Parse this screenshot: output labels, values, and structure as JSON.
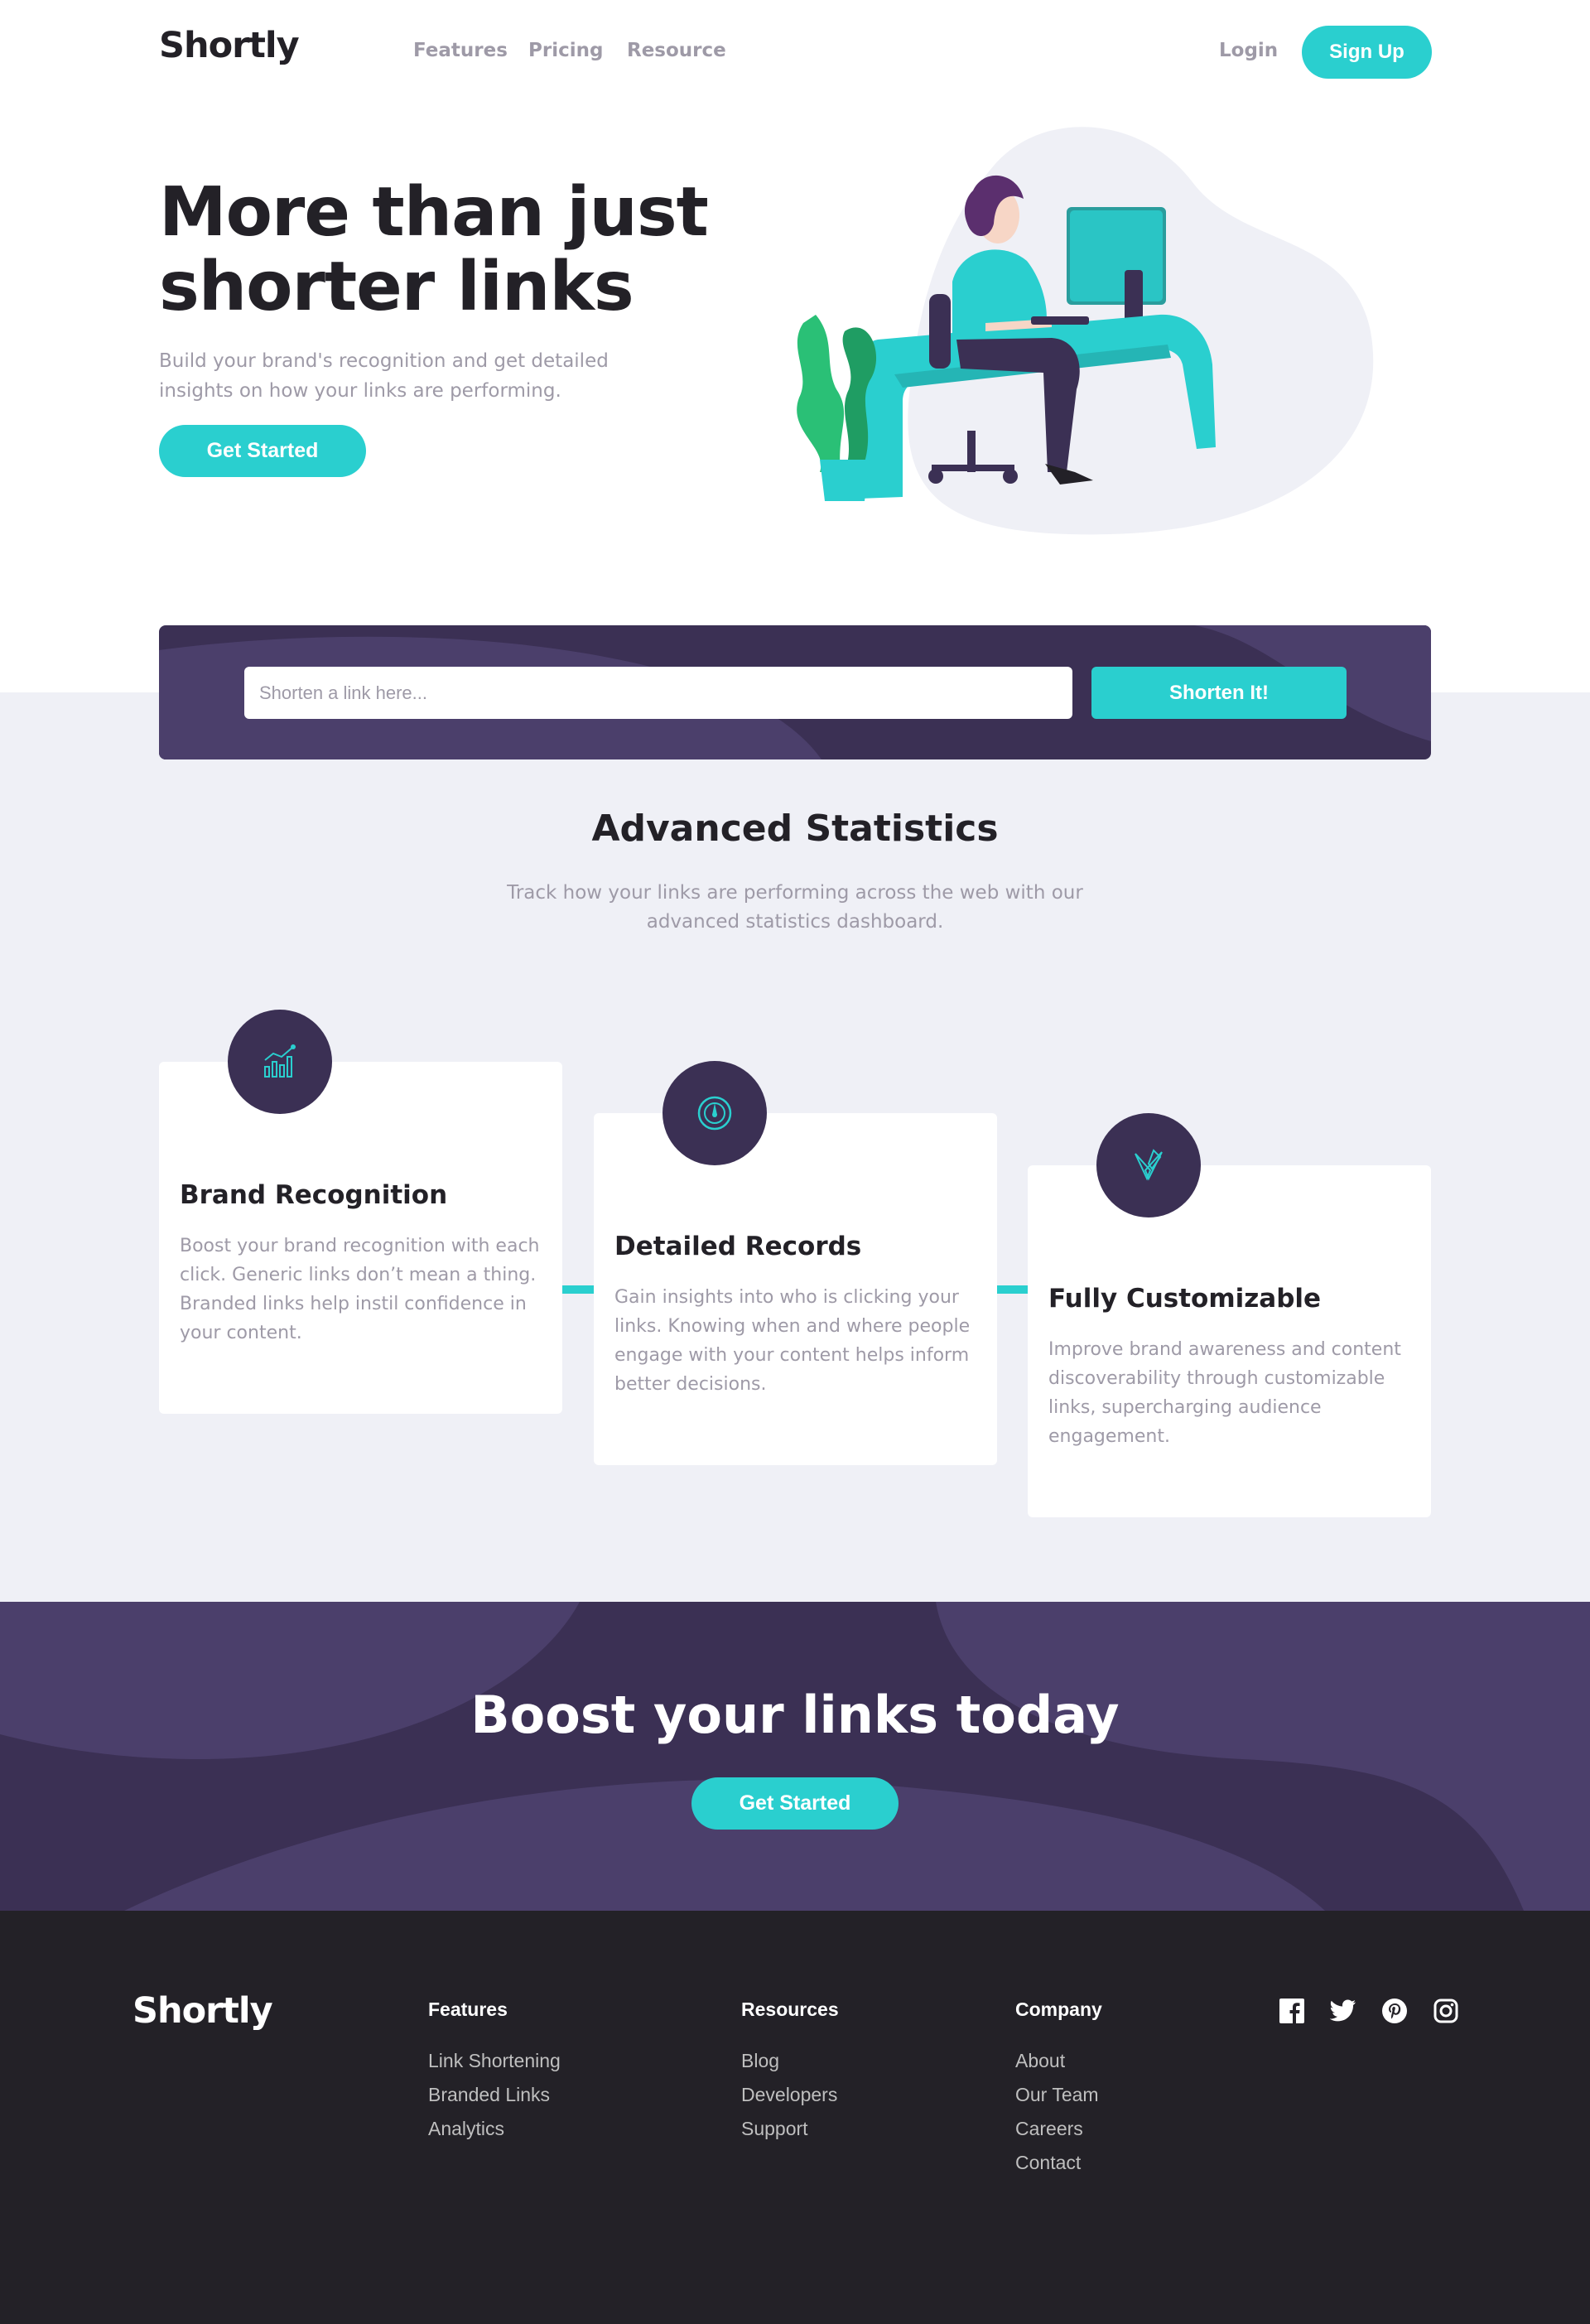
{
  "nav": {
    "logo": "Shortly",
    "links": [
      "Features",
      "Pricing",
      "Resource"
    ],
    "login": "Login",
    "signup": "Sign Up"
  },
  "hero": {
    "title": "More than just shorter links",
    "subtitle": "Build your brand's recognition and get detailed insights on how your links are performing.",
    "cta": "Get Started"
  },
  "shorten": {
    "placeholder": "Shorten a link here...",
    "button": "Shorten It!"
  },
  "stats": {
    "title": "Advanced Statistics",
    "subtitle": "Track how your links are performing across the web with our advanced statistics dashboard.",
    "cards": [
      {
        "icon": "chart-icon",
        "title": "Brand Recognition",
        "text": "Boost your brand recognition with each click. Generic links don’t mean a thing. Branded links help instil confidence in your content."
      },
      {
        "icon": "gauge-icon",
        "title": "Detailed Records",
        "text": "Gain insights into who is clicking your links. Knowing when and where people engage with your content helps inform better decisions."
      },
      {
        "icon": "pens-icon",
        "title": "Fully Customizable",
        "text": "Improve brand awareness and content discoverability through customizable links, supercharging audience engagement."
      }
    ]
  },
  "boost": {
    "title": "Boost your links today",
    "cta": "Get Started"
  },
  "footer": {
    "logo": "Shortly",
    "columns": [
      {
        "heading": "Features",
        "links": [
          "Link Shortening",
          "Branded Links",
          "Analytics"
        ]
      },
      {
        "heading": "Resources",
        "links": [
          "Blog",
          "Developers",
          "Support"
        ]
      },
      {
        "heading": "Company",
        "links": [
          "About",
          "Our Team",
          "Careers",
          "Contact"
        ]
      }
    ],
    "socials": [
      "facebook-icon",
      "twitter-icon",
      "pinterest-icon",
      "instagram-icon"
    ]
  },
  "colors": {
    "cyan": "#2acfcf",
    "dark_violet": "#3b3054",
    "very_dark": "#232127",
    "gray": "#9e9aa7",
    "light_bg": "#eff0f6"
  }
}
